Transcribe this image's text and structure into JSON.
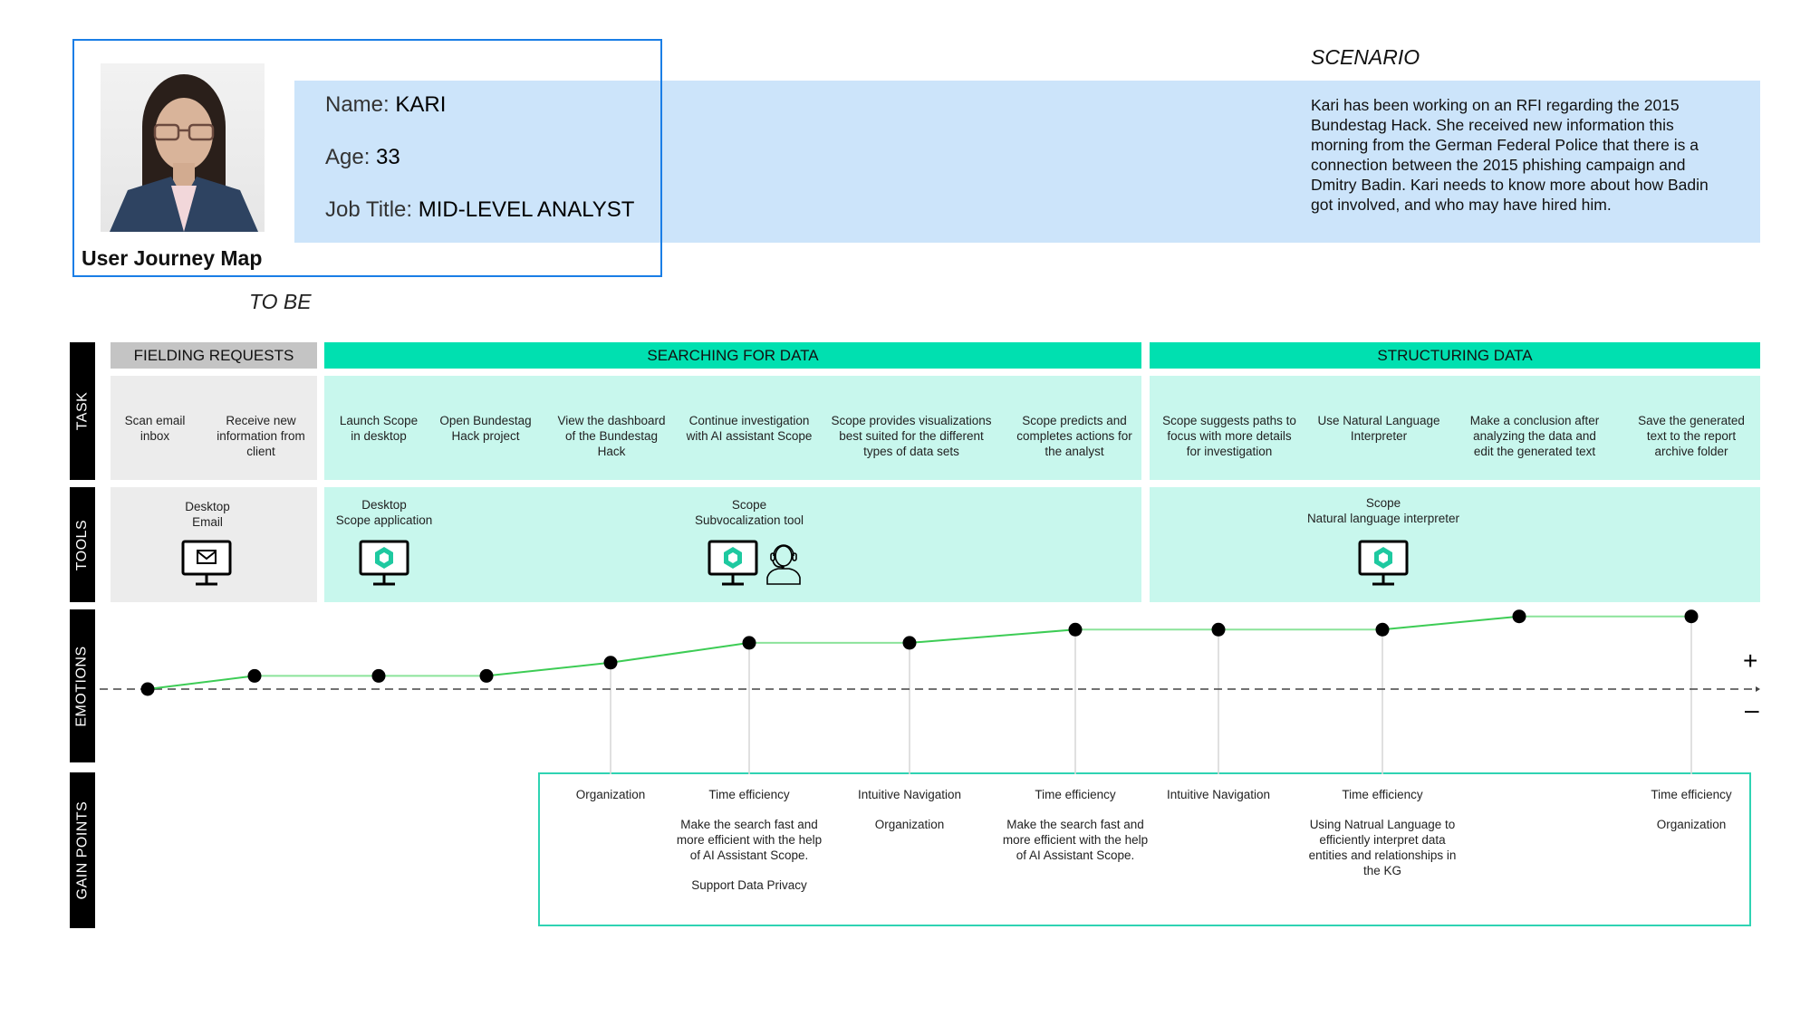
{
  "persona": {
    "name_label": "Name:",
    "name_value": "KARI",
    "age_label": "Age:",
    "age_value": "33",
    "job_label": "Job Title:",
    "job_value": "MID-LEVEL ANALYST",
    "photo_icon": "person-photo"
  },
  "header": {
    "title": "User Journey Map",
    "state": "TO BE",
    "scenario_title": "SCENARIO",
    "scenario_text": "Kari has been working on an RFI regarding the 2015 Bundestag Hack. She received new information this morning from the German Federal Police that there is a connection between the 2015 phishing campaign and Dmitry Badin. Kari needs to know more about how Badin got involved, and who may have hired him."
  },
  "row_labels": [
    "TASK",
    "TOOLS",
    "EMOTIONS",
    "GAIN POINTS"
  ],
  "phases": [
    {
      "label": "FIELDING REQUESTS",
      "color": "#c4c4c4"
    },
    {
      "label": "SEARCHING FOR DATA",
      "color": "#00e0b0"
    },
    {
      "label": "STRUCTURING DATA",
      "color": "#00e0b0"
    }
  ],
  "tasks": [
    "Scan email inbox",
    "Receive new information from client",
    "Launch Scope in desktop",
    "Open Bundestag Hack project",
    "View the dashboard of the Bundestag Hack",
    "Continue investigation with AI assistant Scope",
    "Scope provides visualizations best suited for the different types of data sets",
    "Scope predicts and completes actions for the analyst",
    "Scope suggests paths to focus with more details for investigation",
    "Use Natural Language Interpreter",
    "Make a conclusion after analyzing the data and edit the generated text",
    "Save the generated text to the report archive folder"
  ],
  "tools": [
    {
      "line1": "Desktop",
      "line2": "Email",
      "icon": "desktop-email-icon"
    },
    {
      "line1": "Desktop",
      "line2": "Scope application",
      "icon": "desktop-scope-icon"
    },
    {
      "line1": "Scope",
      "line2": "Subvocalization tool",
      "icon": "desktop-scope-icon",
      "icon2": "headset-user-icon"
    },
    {
      "line1": "Scope",
      "line2": "Natural language interpreter",
      "icon": "desktop-scope-icon"
    }
  ],
  "emotions": {
    "signs": {
      "positive": "+",
      "negative": "–"
    },
    "line_color": "#3dcc55",
    "scores": [
      0,
      1,
      1,
      1,
      2,
      3.5,
      3.5,
      4.5,
      4.5,
      4.5,
      5.5,
      5.5
    ],
    "max_score": 6
  },
  "gain_points": [
    {
      "task_index": 4,
      "items": [
        "Organization"
      ]
    },
    {
      "task_index": 5,
      "items": [
        "Time efficiency",
        "Make the search fast and more efficient with the help of AI Assistant Scope.",
        "Support Data Privacy"
      ]
    },
    {
      "task_index": 6,
      "items": [
        "Intuitive Navigation",
        "Organization"
      ]
    },
    {
      "task_index": 7,
      "items": [
        "Time efficiency",
        "Make the search fast and more efficient with the help of AI Assistant Scope."
      ]
    },
    {
      "task_index": 8,
      "items": [
        "Intuitive Navigation"
      ]
    },
    {
      "task_index": 9,
      "items": [
        "Time efficiency",
        "Using Natrual Language to efficiently interpret data entities and relationships in the KG"
      ]
    },
    {
      "task_index": 11,
      "items": [
        "Time efficiency",
        "Organization"
      ]
    }
  ]
}
